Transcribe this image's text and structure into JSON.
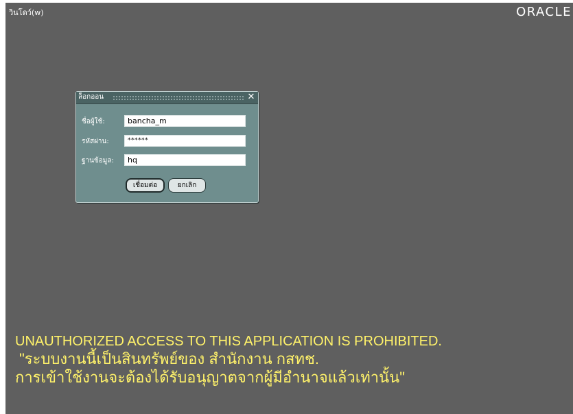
{
  "window": {
    "menu_label": "วินโดว์(w)",
    "logo_text": "ORACLE"
  },
  "login_dialog": {
    "title": "ล็อกออน",
    "fields": [
      {
        "label": "ชื่อผู้ใช้:",
        "value": "bancha_m"
      },
      {
        "label": "รหัสผ่าน:",
        "value": "******"
      },
      {
        "label": "ฐานข้อมูล:",
        "value": "hq"
      }
    ],
    "buttons": {
      "connect": "เชื่อมต่อ",
      "cancel": "ยกเลิก"
    }
  },
  "banner": {
    "line1": "UNAUTHORIZED ACCESS TO THIS APPLICATION IS PROHIBITED.",
    "line2": "\"ระบบงานนี้เป็นสินทรัพย์ของ สำนักงาน กสทช.",
    "line3": "การเข้าใช้งานจะต้องได้รับอนุญาตจากผู้มีอำนาจแล้วเท่านั้น\""
  },
  "colors": {
    "background": "#5f5f5f",
    "dialog_bg": "#6f8e8e",
    "titlebar_bg": "#4a6363",
    "warning_text": "#fff26a"
  }
}
